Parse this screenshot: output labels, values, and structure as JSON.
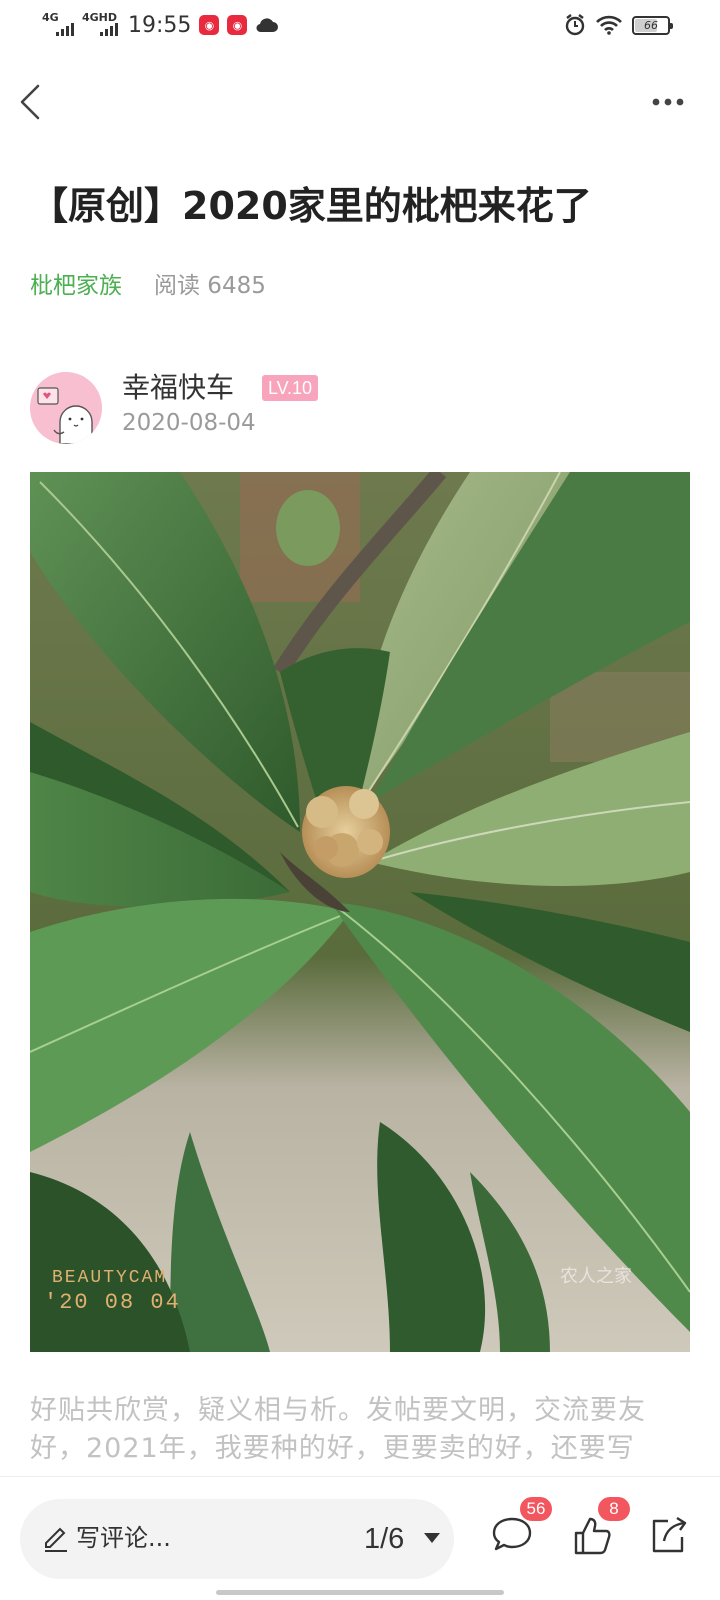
{
  "status_bar": {
    "time": "19:55",
    "signal_1": "4G",
    "signal_2": "4GHD",
    "battery": "66",
    "battery_level": 0.66,
    "icons": [
      "alarm-icon",
      "wifi-icon",
      "battery-icon",
      "weibo-icon",
      "weibo-icon",
      "cloud-icon"
    ]
  },
  "nav": {
    "back_icon": "chevron-left-icon",
    "more_icon": "more-horizontal-icon"
  },
  "post": {
    "title": "【原创】2020家里的枇杷来花了",
    "forum": "枇杷家族",
    "reads": "阅读 6485",
    "author": {
      "name": "幸福快车",
      "level": "LV.10",
      "date": "2020-08-04"
    },
    "photo": {
      "stamp_line1": "BEAUTYCAM",
      "stamp_line2": "'20 08 04",
      "watermark": "农人之家"
    },
    "body": "好贴共欣赏，疑义相与析。发帖要文明，交流要友好，2021年，我要种的好，更要卖的好，还要写"
  },
  "bottom_bar": {
    "comment_placeholder": "写评论...",
    "page_indicator": "1/6",
    "comments_count": "56",
    "likes_count": "8",
    "icons": [
      "pen-icon",
      "comment-icon",
      "thumbs-up-icon",
      "share-icon"
    ]
  },
  "colors": {
    "forum_green": "#4caf50",
    "level_pink": "#f8a4bd",
    "badge_red": "#f2575f",
    "muted_gray": "#9a9a9a"
  }
}
